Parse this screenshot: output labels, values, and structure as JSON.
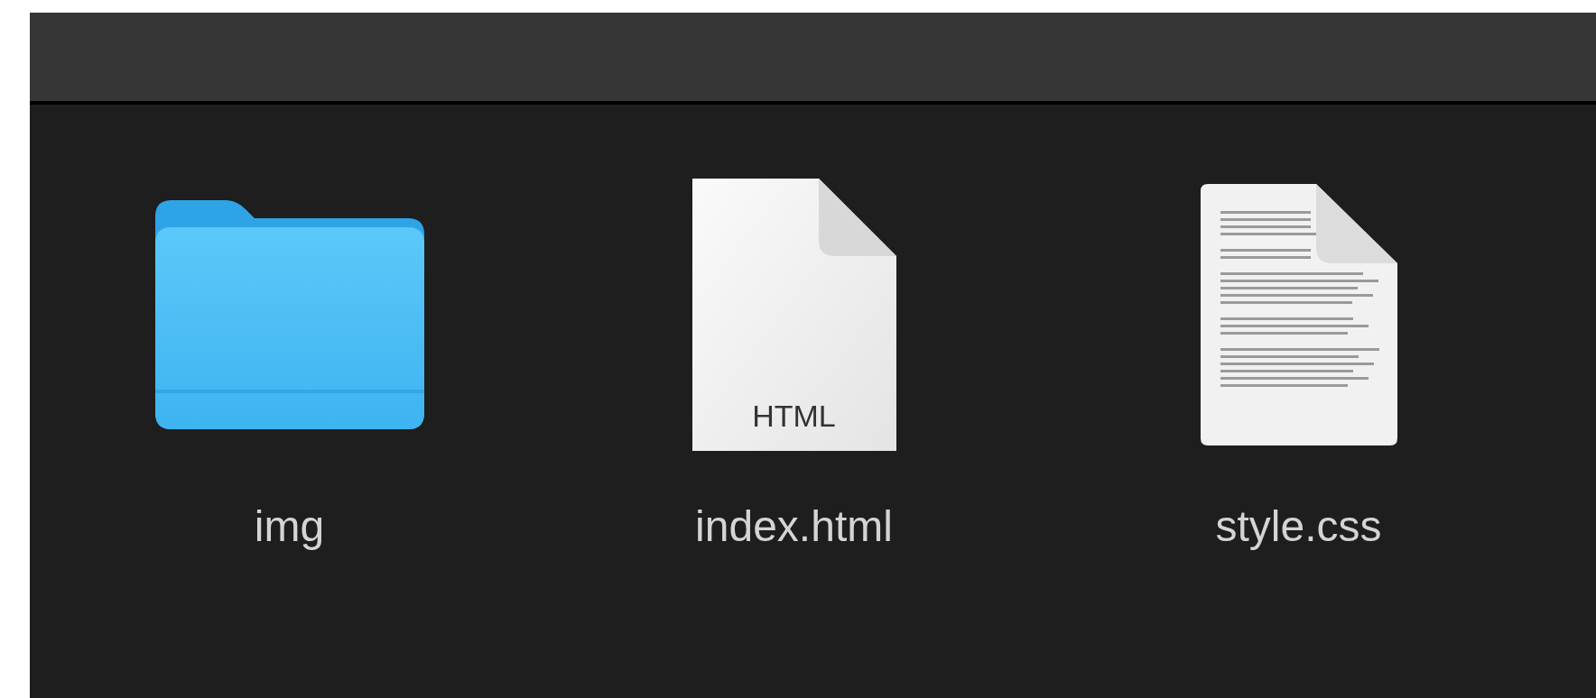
{
  "items": [
    {
      "kind": "folder",
      "name": "img"
    },
    {
      "kind": "html",
      "name": "index.html",
      "badge": "HTML"
    },
    {
      "kind": "text",
      "name": "style.css"
    }
  ]
}
